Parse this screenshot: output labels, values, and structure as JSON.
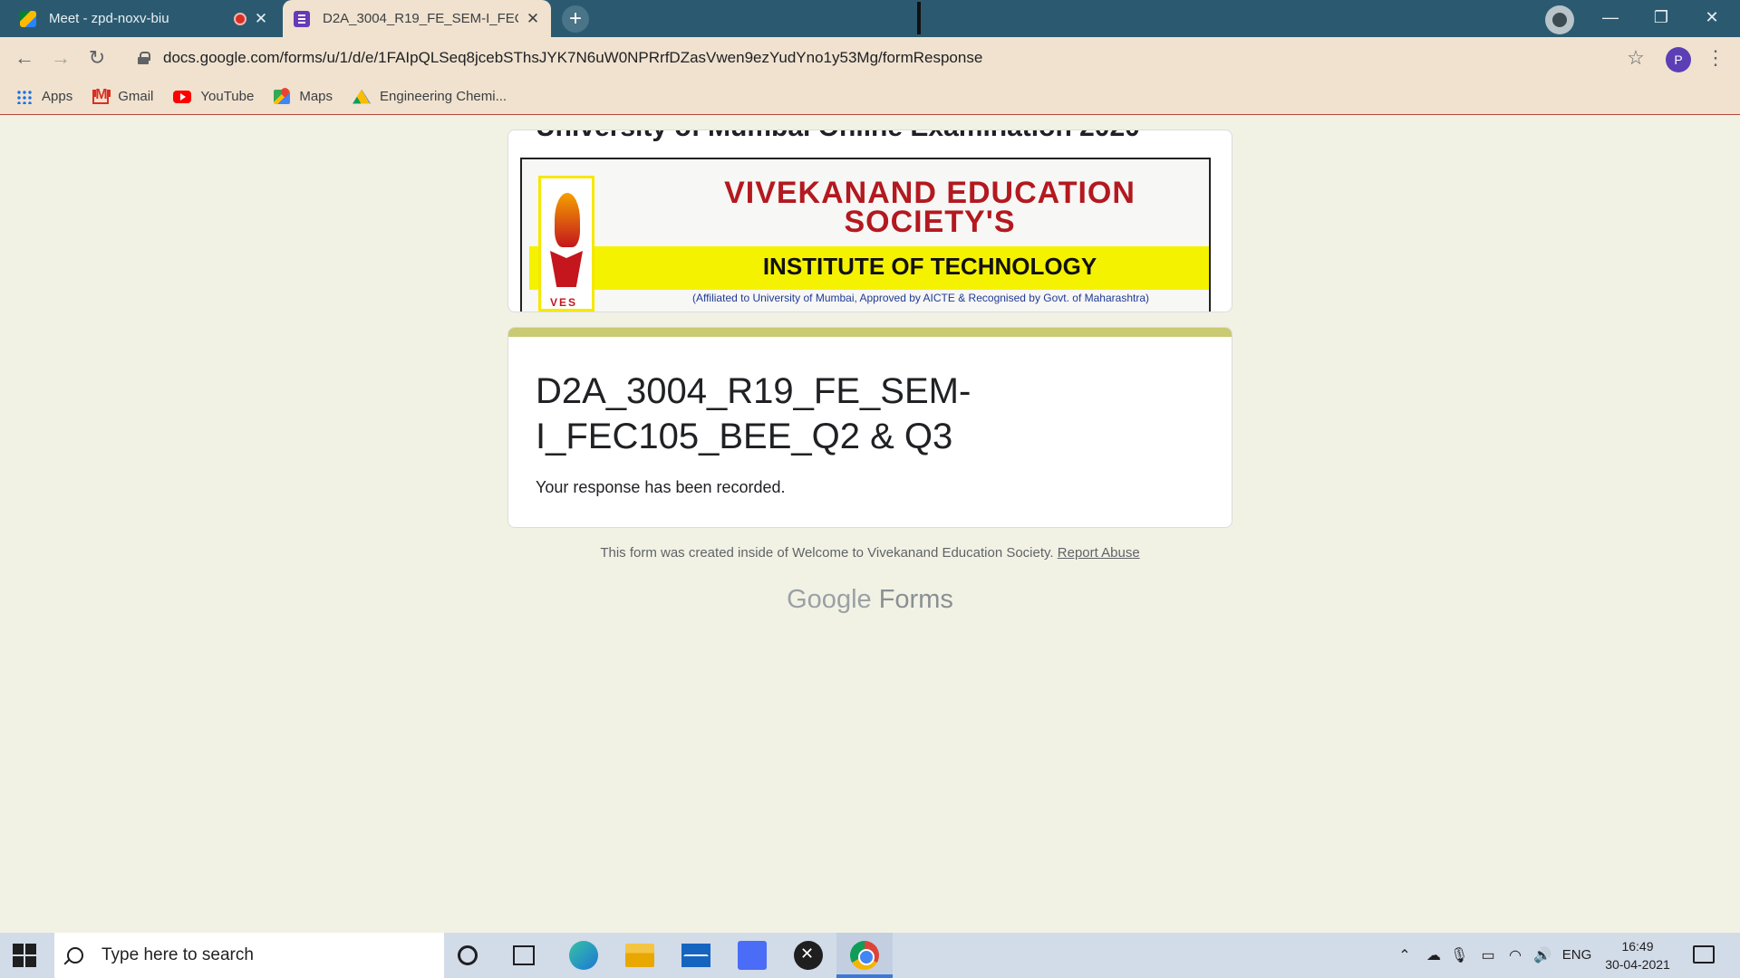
{
  "browser": {
    "tabs": [
      {
        "title": "Meet - zpd-noxv-biu",
        "recording": true,
        "active": false
      },
      {
        "title": "D2A_3004_R19_FE_SEM-I_FEC105_BEE_Q2 & Q3",
        "active": true
      }
    ],
    "url": "docs.google.com/forms/u/1/d/e/1FAIpQLSeq8jcebSThsJYK7N6uW0NPRrfDZasVwen9ezYudYno1y53Mg/formResponse",
    "profile_initial": "P",
    "bookmarks": [
      "Apps",
      "Gmail",
      "YouTube",
      "Maps",
      "Engineering Chemi..."
    ]
  },
  "form": {
    "header_cut_text": "University of Mumbai Online Examination 2020",
    "banner": {
      "line1": "VIVEKANAND EDUCATION",
      "line2": "SOCIETY'S",
      "line3": "INSTITUTE OF TECHNOLOGY",
      "line4": "(Affiliated to University of Mumbai, Approved by AICTE & Recognised by Govt. of Maharashtra)",
      "logo_text": "VES"
    },
    "title": "D2A_3004_R19_FE_SEM-I_FEC105_BEE_Q2 & Q3",
    "confirmation": "Your response has been recorded.",
    "footer_note": "This form was created inside of Welcome to Vivekanand Education Society.",
    "report_abuse": "Report Abuse",
    "brand_google": "Google",
    "brand_forms": "Forms"
  },
  "taskbar": {
    "search_placeholder": "Type here to search",
    "language": "ENG",
    "time": "16:49",
    "date": "30-04-2021"
  },
  "colors": {
    "page_bg": "#f2f2e4",
    "accent": "#c9ca72",
    "tabstrip": "#2b5a70"
  }
}
